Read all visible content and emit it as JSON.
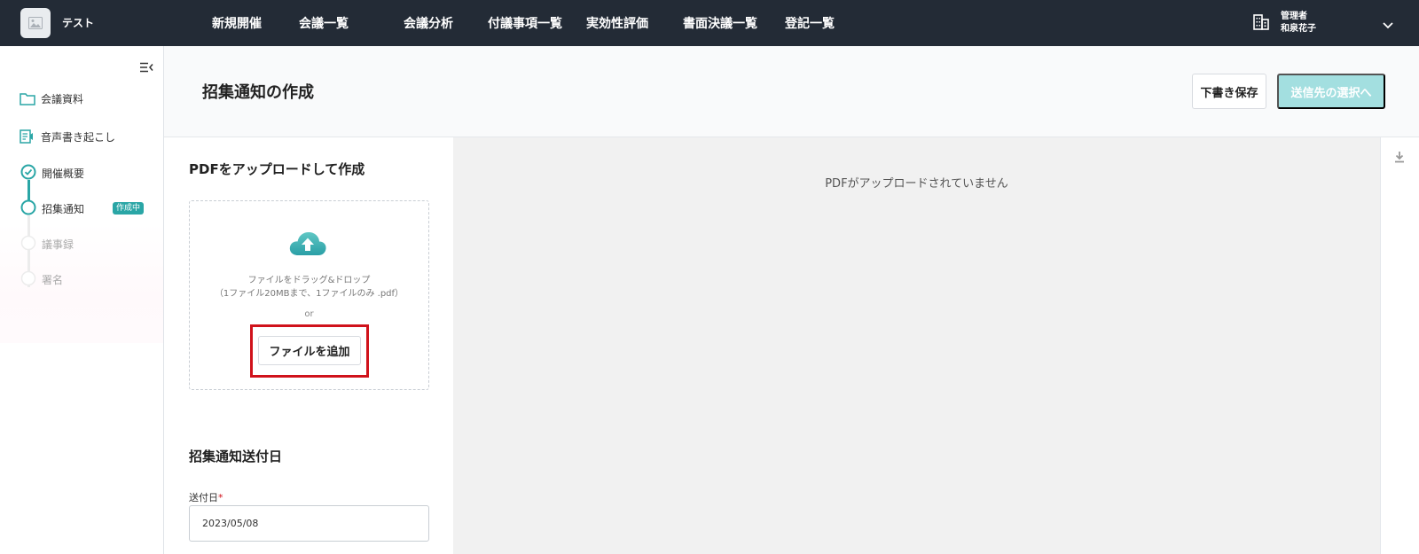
{
  "app": {
    "name": "テスト"
  },
  "nav": [
    {
      "label": "新規開催"
    },
    {
      "label": "会議一覧"
    },
    {
      "label": "会議分析"
    },
    {
      "label": "付議事項一覧"
    },
    {
      "label": "実効性評価"
    },
    {
      "label": "書面決議一覧"
    },
    {
      "label": "登記一覧"
    }
  ],
  "user": {
    "role": "管理者",
    "name": "和泉花子"
  },
  "sidebar": {
    "links": [
      {
        "label": "会議資料",
        "icon": "folder-icon"
      },
      {
        "label": "音声書き起こし",
        "icon": "transcription-icon"
      }
    ],
    "steps": [
      {
        "label": "開催概要",
        "state": "done"
      },
      {
        "label": "招集通知",
        "state": "current",
        "badge": "作成中"
      },
      {
        "label": "議事録",
        "state": "pending"
      },
      {
        "label": "署名",
        "state": "pending"
      }
    ]
  },
  "header": {
    "title": "招集通知の作成",
    "save_draft": "下書き保存",
    "next": "送信先の選択へ"
  },
  "upload": {
    "heading": "PDFをアップロードして作成",
    "drop_text": "ファイルをドラッグ&ドロップ",
    "limit_text": "（1ファイル20MBまで、1ファイルのみ .pdf）",
    "or": "or",
    "add_button": "ファイルを追加"
  },
  "send_date": {
    "heading": "招集通知送付日",
    "label": "送付日",
    "required_mark": "*",
    "value": "2023/05/08"
  },
  "preview": {
    "empty_text": "PDFがアップロードされていません"
  },
  "colors": {
    "accent": "#2aa6a6",
    "topbar": "#232b36",
    "highlight": "#d0121b"
  }
}
